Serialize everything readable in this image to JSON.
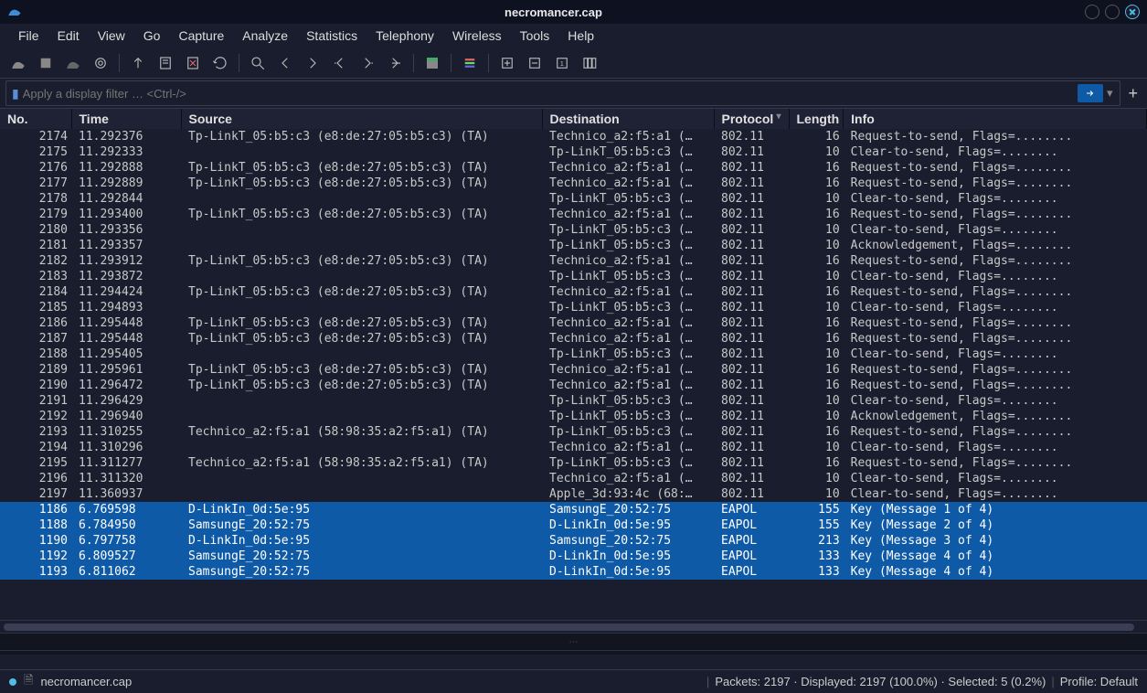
{
  "window": {
    "title": "necromancer.cap"
  },
  "menu": {
    "items": [
      "File",
      "Edit",
      "View",
      "Go",
      "Capture",
      "Analyze",
      "Statistics",
      "Telephony",
      "Wireless",
      "Tools",
      "Help"
    ]
  },
  "filter": {
    "placeholder": "Apply a display filter … <Ctrl-/>"
  },
  "columns": {
    "no": "No.",
    "time": "Time",
    "source": "Source",
    "destination": "Destination",
    "protocol": "Protocol",
    "length": "Length",
    "info": "Info"
  },
  "packets": [
    {
      "no": 2174,
      "time": "11.292376",
      "src": "Tp-LinkT_05:b5:c3 (e8:de:27:05:b5:c3) (TA)",
      "dst": "Technico_a2:f5:a1 (…",
      "proto": "802.11",
      "len": 16,
      "info": "Request-to-send, Flags=........"
    },
    {
      "no": 2175,
      "time": "11.292333",
      "src": "",
      "dst": "Tp-LinkT_05:b5:c3 (…",
      "proto": "802.11",
      "len": 10,
      "info": "Clear-to-send, Flags=........"
    },
    {
      "no": 2176,
      "time": "11.292888",
      "src": "Tp-LinkT_05:b5:c3 (e8:de:27:05:b5:c3) (TA)",
      "dst": "Technico_a2:f5:a1 (…",
      "proto": "802.11",
      "len": 16,
      "info": "Request-to-send, Flags=........"
    },
    {
      "no": 2177,
      "time": "11.292889",
      "src": "Tp-LinkT_05:b5:c3 (e8:de:27:05:b5:c3) (TA)",
      "dst": "Technico_a2:f5:a1 (…",
      "proto": "802.11",
      "len": 16,
      "info": "Request-to-send, Flags=........"
    },
    {
      "no": 2178,
      "time": "11.292844",
      "src": "",
      "dst": "Tp-LinkT_05:b5:c3 (…",
      "proto": "802.11",
      "len": 10,
      "info": "Clear-to-send, Flags=........"
    },
    {
      "no": 2179,
      "time": "11.293400",
      "src": "Tp-LinkT_05:b5:c3 (e8:de:27:05:b5:c3) (TA)",
      "dst": "Technico_a2:f5:a1 (…",
      "proto": "802.11",
      "len": 16,
      "info": "Request-to-send, Flags=........"
    },
    {
      "no": 2180,
      "time": "11.293356",
      "src": "",
      "dst": "Tp-LinkT_05:b5:c3 (…",
      "proto": "802.11",
      "len": 10,
      "info": "Clear-to-send, Flags=........"
    },
    {
      "no": 2181,
      "time": "11.293357",
      "src": "",
      "dst": "Tp-LinkT_05:b5:c3 (…",
      "proto": "802.11",
      "len": 10,
      "info": "Acknowledgement, Flags=........"
    },
    {
      "no": 2182,
      "time": "11.293912",
      "src": "Tp-LinkT_05:b5:c3 (e8:de:27:05:b5:c3) (TA)",
      "dst": "Technico_a2:f5:a1 (…",
      "proto": "802.11",
      "len": 16,
      "info": "Request-to-send, Flags=........"
    },
    {
      "no": 2183,
      "time": "11.293872",
      "src": "",
      "dst": "Tp-LinkT_05:b5:c3 (…",
      "proto": "802.11",
      "len": 10,
      "info": "Clear-to-send, Flags=........"
    },
    {
      "no": 2184,
      "time": "11.294424",
      "src": "Tp-LinkT_05:b5:c3 (e8:de:27:05:b5:c3) (TA)",
      "dst": "Technico_a2:f5:a1 (…",
      "proto": "802.11",
      "len": 16,
      "info": "Request-to-send, Flags=........"
    },
    {
      "no": 2185,
      "time": "11.294893",
      "src": "",
      "dst": "Tp-LinkT_05:b5:c3 (…",
      "proto": "802.11",
      "len": 10,
      "info": "Clear-to-send, Flags=........"
    },
    {
      "no": 2186,
      "time": "11.295448",
      "src": "Tp-LinkT_05:b5:c3 (e8:de:27:05:b5:c3) (TA)",
      "dst": "Technico_a2:f5:a1 (…",
      "proto": "802.11",
      "len": 16,
      "info": "Request-to-send, Flags=........"
    },
    {
      "no": 2187,
      "time": "11.295448",
      "src": "Tp-LinkT_05:b5:c3 (e8:de:27:05:b5:c3) (TA)",
      "dst": "Technico_a2:f5:a1 (…",
      "proto": "802.11",
      "len": 16,
      "info": "Request-to-send, Flags=........"
    },
    {
      "no": 2188,
      "time": "11.295405",
      "src": "",
      "dst": "Tp-LinkT_05:b5:c3 (…",
      "proto": "802.11",
      "len": 10,
      "info": "Clear-to-send, Flags=........"
    },
    {
      "no": 2189,
      "time": "11.295961",
      "src": "Tp-LinkT_05:b5:c3 (e8:de:27:05:b5:c3) (TA)",
      "dst": "Technico_a2:f5:a1 (…",
      "proto": "802.11",
      "len": 16,
      "info": "Request-to-send, Flags=........"
    },
    {
      "no": 2190,
      "time": "11.296472",
      "src": "Tp-LinkT_05:b5:c3 (e8:de:27:05:b5:c3) (TA)",
      "dst": "Technico_a2:f5:a1 (…",
      "proto": "802.11",
      "len": 16,
      "info": "Request-to-send, Flags=........"
    },
    {
      "no": 2191,
      "time": "11.296429",
      "src": "",
      "dst": "Tp-LinkT_05:b5:c3 (…",
      "proto": "802.11",
      "len": 10,
      "info": "Clear-to-send, Flags=........"
    },
    {
      "no": 2192,
      "time": "11.296940",
      "src": "",
      "dst": "Tp-LinkT_05:b5:c3 (…",
      "proto": "802.11",
      "len": 10,
      "info": "Acknowledgement, Flags=........"
    },
    {
      "no": 2193,
      "time": "11.310255",
      "src": "Technico_a2:f5:a1 (58:98:35:a2:f5:a1) (TA)",
      "dst": "Tp-LinkT_05:b5:c3 (…",
      "proto": "802.11",
      "len": 16,
      "info": "Request-to-send, Flags=........"
    },
    {
      "no": 2194,
      "time": "11.310296",
      "src": "",
      "dst": "Technico_a2:f5:a1 (…",
      "proto": "802.11",
      "len": 10,
      "info": "Clear-to-send, Flags=........"
    },
    {
      "no": 2195,
      "time": "11.311277",
      "src": "Technico_a2:f5:a1 (58:98:35:a2:f5:a1) (TA)",
      "dst": "Tp-LinkT_05:b5:c3 (…",
      "proto": "802.11",
      "len": 16,
      "info": "Request-to-send, Flags=........"
    },
    {
      "no": 2196,
      "time": "11.311320",
      "src": "",
      "dst": "Technico_a2:f5:a1 (…",
      "proto": "802.11",
      "len": 10,
      "info": "Clear-to-send, Flags=........"
    },
    {
      "no": 2197,
      "time": "11.360937",
      "src": "",
      "dst": "Apple_3d:93:4c (68:…",
      "proto": "802.11",
      "len": 10,
      "info": "Clear-to-send, Flags=........"
    },
    {
      "no": 1186,
      "time": "6.769598",
      "src": "D-LinkIn_0d:5e:95",
      "dst": "SamsungE_20:52:75",
      "proto": "EAPOL",
      "len": 155,
      "info": "Key (Message 1 of 4)",
      "selected": true
    },
    {
      "no": 1188,
      "time": "6.784950",
      "src": "SamsungE_20:52:75",
      "dst": "D-LinkIn_0d:5e:95",
      "proto": "EAPOL",
      "len": 155,
      "info": "Key (Message 2 of 4)",
      "selected": true
    },
    {
      "no": 1190,
      "time": "6.797758",
      "src": "D-LinkIn_0d:5e:95",
      "dst": "SamsungE_20:52:75",
      "proto": "EAPOL",
      "len": 213,
      "info": "Key (Message 3 of 4)",
      "selected": true
    },
    {
      "no": 1192,
      "time": "6.809527",
      "src": "SamsungE_20:52:75",
      "dst": "D-LinkIn_0d:5e:95",
      "proto": "EAPOL",
      "len": 133,
      "info": "Key (Message 4 of 4)",
      "selected": true
    },
    {
      "no": 1193,
      "time": "6.811062",
      "src": "SamsungE_20:52:75",
      "dst": "D-LinkIn_0d:5e:95",
      "proto": "EAPOL",
      "len": 133,
      "info": "Key (Message 4 of 4)",
      "selected": true
    }
  ],
  "status": {
    "file": "necromancer.cap",
    "packets": "Packets: 2197 · Displayed: 2197 (100.0%) · Selected: 5 (0.2%)",
    "profile": "Profile: Default"
  }
}
